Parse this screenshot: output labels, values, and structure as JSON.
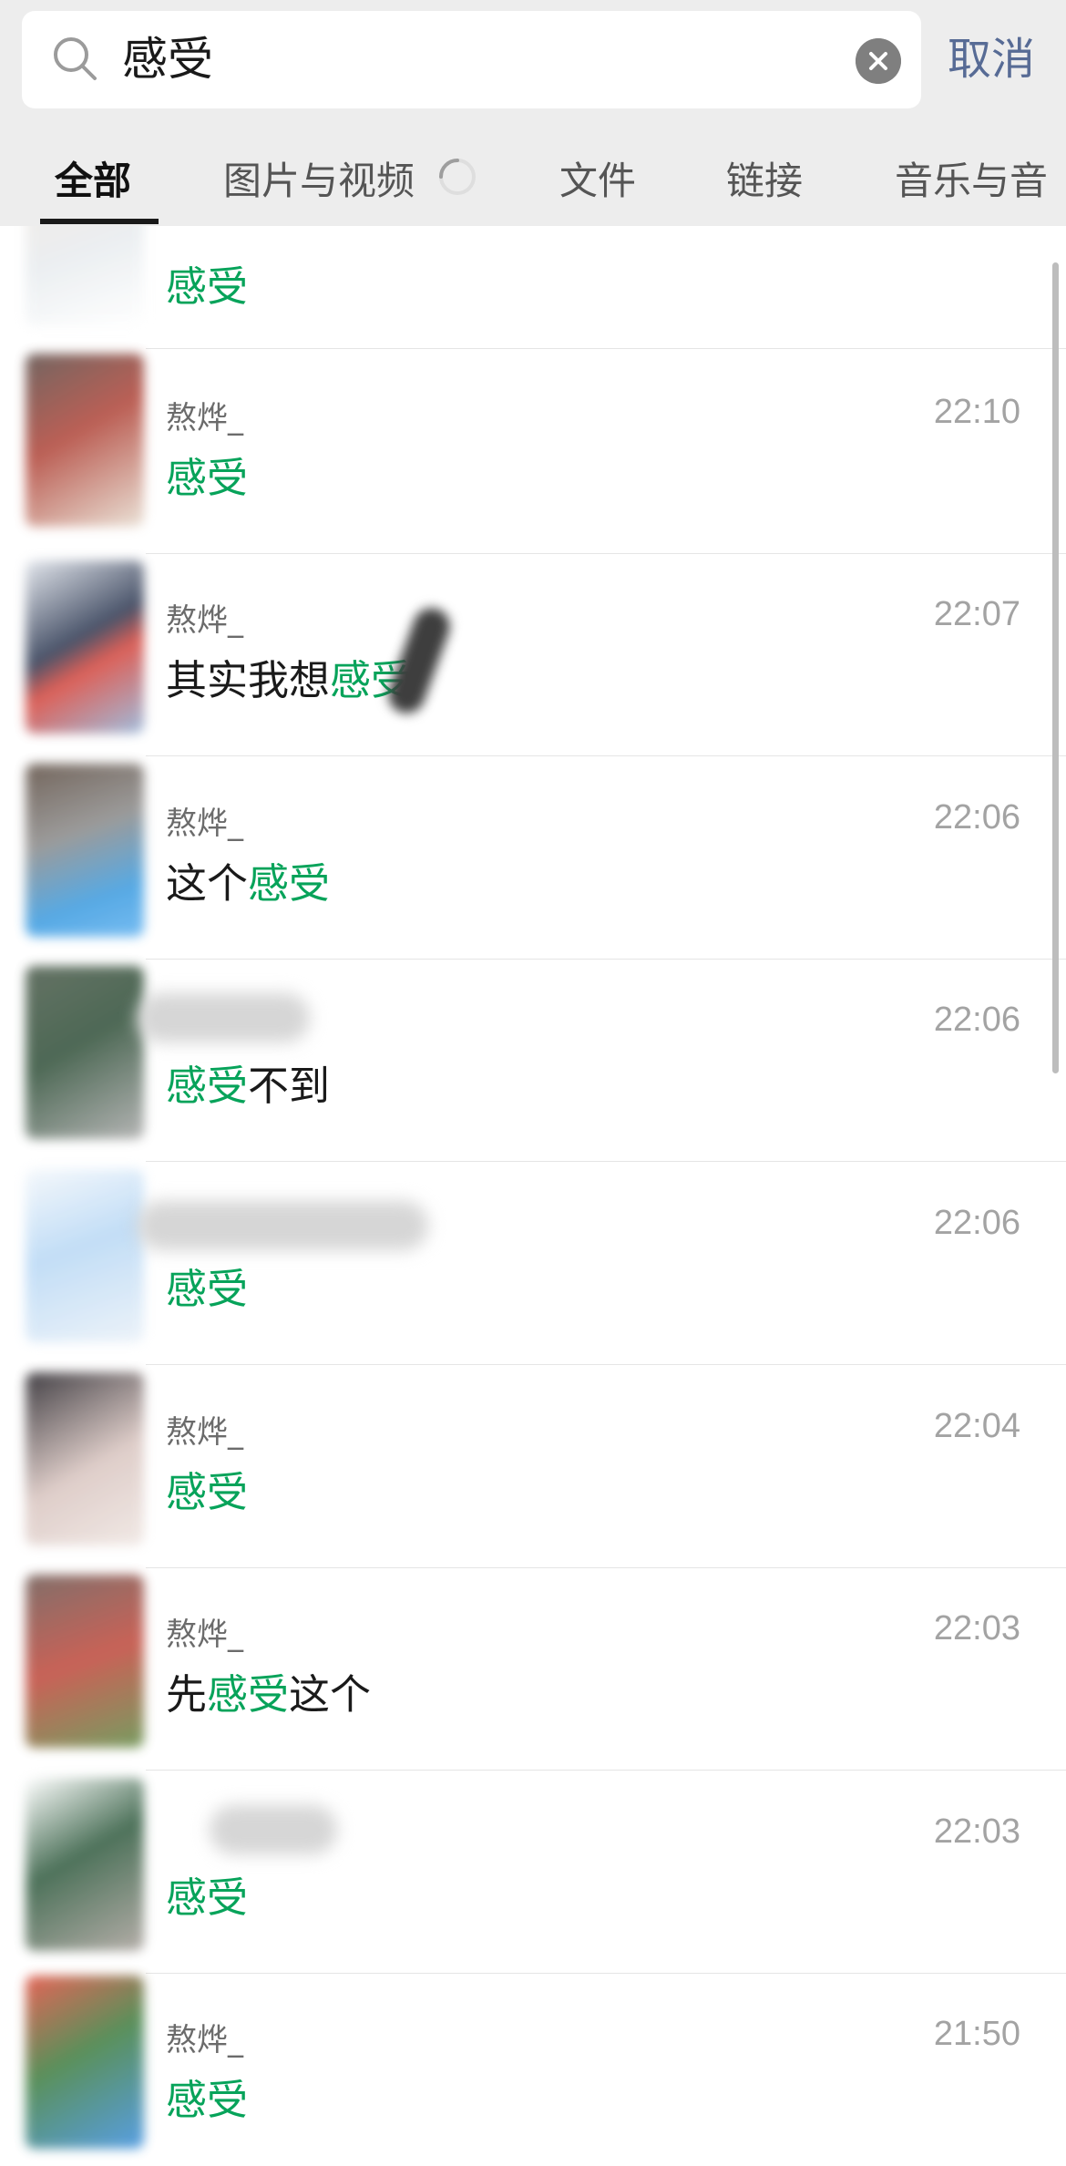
{
  "search": {
    "query": "感受",
    "cancel_label": "取消"
  },
  "tabs": [
    {
      "label": "全部",
      "active": true
    },
    {
      "label": "图片与视频",
      "loading": true
    },
    {
      "label": "文件"
    },
    {
      "label": "链接"
    },
    {
      "label": "音乐与音"
    }
  ],
  "results": [
    {
      "sender": "",
      "time": "",
      "pre": "",
      "hl": "感受",
      "post": ""
    },
    {
      "sender": "熬烨_",
      "time": "22:10",
      "pre": "",
      "hl": "感受",
      "post": ""
    },
    {
      "sender": "熬烨_",
      "time": "22:07",
      "pre": "其实我想",
      "hl": "感受",
      "post": ""
    },
    {
      "sender": "熬烨_",
      "time": "22:06",
      "pre": "这个",
      "hl": "感受",
      "post": ""
    },
    {
      "sender": "",
      "time": "22:06",
      "pre": "",
      "hl": "感受",
      "post": "不到"
    },
    {
      "sender": "",
      "time": "22:06",
      "pre": "",
      "hl": "感受",
      "post": ""
    },
    {
      "sender": "熬烨_",
      "time": "22:04",
      "pre": "",
      "hl": "感受",
      "post": ""
    },
    {
      "sender": "熬烨_",
      "time": "22:03",
      "pre": "先",
      "hl": "感受",
      "post": "这个"
    },
    {
      "sender": "",
      "time": "22:03",
      "pre": "",
      "hl": "感受",
      "post": ""
    },
    {
      "sender": "熬烨_",
      "time": "21:50",
      "pre": "",
      "hl": "感受",
      "post": ""
    }
  ],
  "colors": {
    "highlight": "#07a35a",
    "link": "#576b95",
    "header_bg": "#ededed"
  }
}
